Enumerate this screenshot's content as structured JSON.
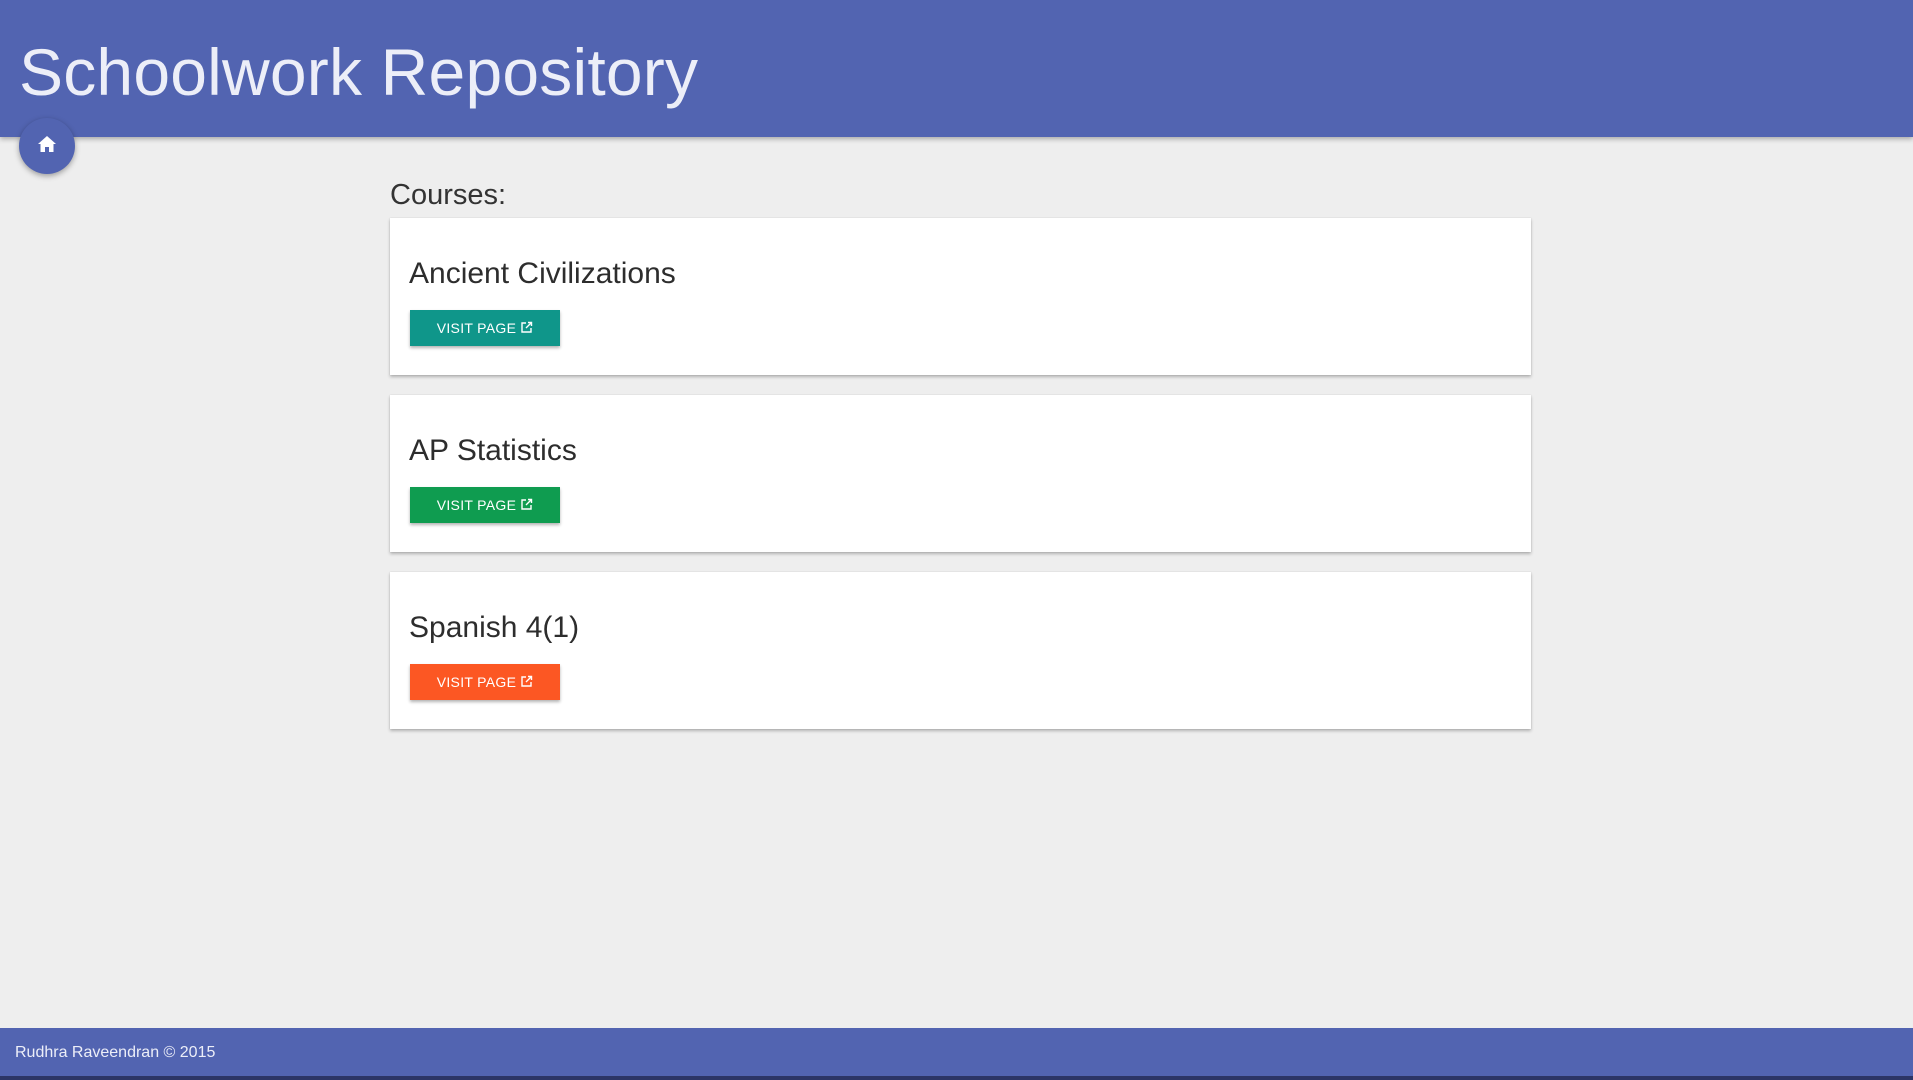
{
  "header": {
    "title": "Schoolwork Repository",
    "background_color": "#5264b1"
  },
  "home_button": {
    "icon": "home-icon"
  },
  "main": {
    "heading": "Courses:",
    "courses": [
      {
        "title": "Ancient Civilizations",
        "button_label": "VISIT PAGE",
        "button_icon": "external-link-icon",
        "button_color": "#0f968a"
      },
      {
        "title": "AP Statistics",
        "button_label": "VISIT PAGE",
        "button_icon": "external-link-icon",
        "button_color": "#0f9c50"
      },
      {
        "title": "Spanish 4(1)",
        "button_label": "VISIT PAGE",
        "button_icon": "external-link-icon",
        "button_color": "#fc5723"
      }
    ]
  },
  "footer": {
    "text": "Rudhra Raveendran © 2015"
  }
}
